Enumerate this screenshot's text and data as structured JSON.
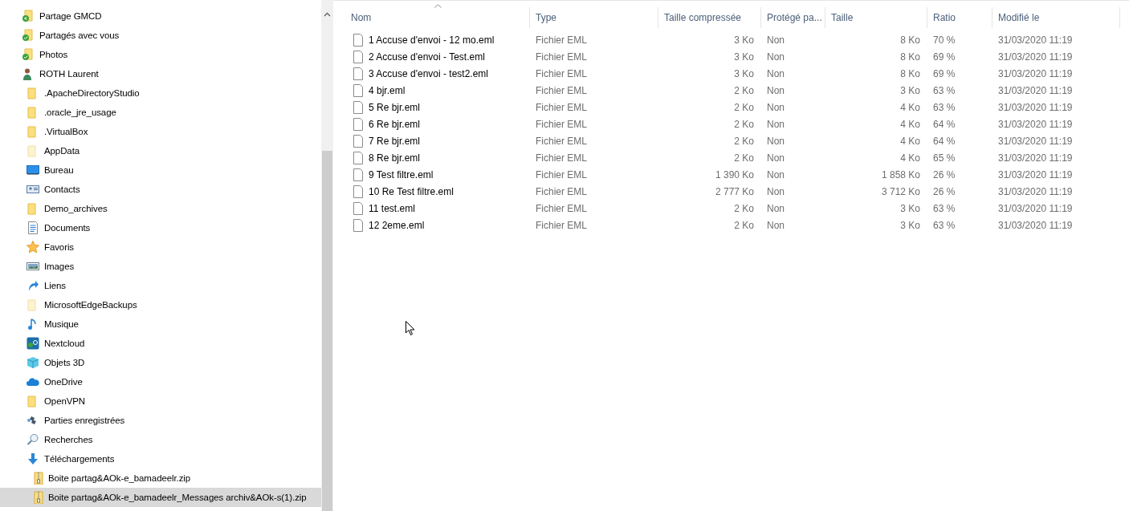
{
  "nav_items": [
    {
      "label": "Partage GMCD",
      "kind": "shared",
      "selected": false
    },
    {
      "label": "Partagés avec vous",
      "kind": "synced",
      "selected": false
    },
    {
      "label": "Photos",
      "kind": "synced",
      "selected": false
    },
    {
      "label": "ROTH Laurent",
      "kind": "user",
      "selected": false,
      "children": [
        {
          "label": ".ApacheDirectoryStudio",
          "kind": "folder",
          "selected": false
        },
        {
          "label": ".oracle_jre_usage",
          "kind": "folder",
          "selected": false
        },
        {
          "label": ".VirtualBox",
          "kind": "folder",
          "selected": false
        },
        {
          "label": "AppData",
          "kind": "hidden",
          "selected": false
        },
        {
          "label": "Bureau",
          "kind": "desktop",
          "selected": false
        },
        {
          "label": "Contacts",
          "kind": "contacts",
          "selected": false
        },
        {
          "label": "Demo_archives",
          "kind": "folder",
          "selected": false
        },
        {
          "label": "Documents",
          "kind": "documents",
          "selected": false
        },
        {
          "label": "Favoris",
          "kind": "star",
          "selected": false
        },
        {
          "label": "Images",
          "kind": "images",
          "selected": false
        },
        {
          "label": "Liens",
          "kind": "link",
          "selected": false
        },
        {
          "label": "MicrosoftEdgeBackups",
          "kind": "hidden",
          "selected": false
        },
        {
          "label": "Musique",
          "kind": "music",
          "selected": false
        },
        {
          "label": "Nextcloud",
          "kind": "nextcloud",
          "selected": false
        },
        {
          "label": "Objets 3D",
          "kind": "cube",
          "selected": false
        },
        {
          "label": "OneDrive",
          "kind": "cloud",
          "selected": false
        },
        {
          "label": "OpenVPN",
          "kind": "folder",
          "selected": false
        },
        {
          "label": "Parties enregistrées",
          "kind": "games",
          "selected": false
        },
        {
          "label": "Recherches",
          "kind": "search",
          "selected": false
        },
        {
          "label": "Téléchargements",
          "kind": "download",
          "selected": false,
          "children": [
            {
              "label": "Boite partag&AOk-e_bamadeelr.zip",
              "kind": "zip",
              "selected": false
            },
            {
              "label": "Boite partag&AOk-e_bamadeelr_Messages archiv&AOk-s(1).zip",
              "kind": "zip",
              "selected": true
            }
          ]
        }
      ]
    }
  ],
  "table": {
    "columns": [
      {
        "label": "Nom",
        "sorted": true
      },
      {
        "label": "Type",
        "sorted": false
      },
      {
        "label": "Taille compressée",
        "sorted": false
      },
      {
        "label": "Protégé pa...",
        "sorted": false
      },
      {
        "label": "Taille",
        "sorted": false
      },
      {
        "label": "Ratio",
        "sorted": false
      },
      {
        "label": "Modifié le",
        "sorted": false
      }
    ],
    "rows": [
      [
        "1 Accuse d'envoi - 12 mo.eml",
        "Fichier EML",
        "3 Ko",
        "Non",
        "8 Ko",
        "70 %",
        "31/03/2020 11:19"
      ],
      [
        "2 Accuse d'envoi - Test.eml",
        "Fichier EML",
        "3 Ko",
        "Non",
        "8 Ko",
        "69 %",
        "31/03/2020 11:19"
      ],
      [
        "3 Accuse d'envoi - test2.eml",
        "Fichier EML",
        "3 Ko",
        "Non",
        "8 Ko",
        "69 %",
        "31/03/2020 11:19"
      ],
      [
        "4 bjr.eml",
        "Fichier EML",
        "2 Ko",
        "Non",
        "3 Ko",
        "63 %",
        "31/03/2020 11:19"
      ],
      [
        "5 Re bjr.eml",
        "Fichier EML",
        "2 Ko",
        "Non",
        "4 Ko",
        "63 %",
        "31/03/2020 11:19"
      ],
      [
        "6 Re bjr.eml",
        "Fichier EML",
        "2 Ko",
        "Non",
        "4 Ko",
        "64 %",
        "31/03/2020 11:19"
      ],
      [
        "7 Re bjr.eml",
        "Fichier EML",
        "2 Ko",
        "Non",
        "4 Ko",
        "64 %",
        "31/03/2020 11:19"
      ],
      [
        "8 Re bjr.eml",
        "Fichier EML",
        "2 Ko",
        "Non",
        "4 Ko",
        "65 %",
        "31/03/2020 11:19"
      ],
      [
        "9 Test filtre.eml",
        "Fichier EML",
        "1 390 Ko",
        "Non",
        "1 858 Ko",
        "26 %",
        "31/03/2020 11:19"
      ],
      [
        "10 Re Test filtre.eml",
        "Fichier EML",
        "2 777 Ko",
        "Non",
        "3 712 Ko",
        "26 %",
        "31/03/2020 11:19"
      ],
      [
        "11 test.eml",
        "Fichier EML",
        "2 Ko",
        "Non",
        "3 Ko",
        "63 %",
        "31/03/2020 11:19"
      ],
      [
        "12 2eme.eml",
        "Fichier EML",
        "2 Ko",
        "Non",
        "3 Ko",
        "63 %",
        "31/03/2020 11:19"
      ]
    ]
  }
}
